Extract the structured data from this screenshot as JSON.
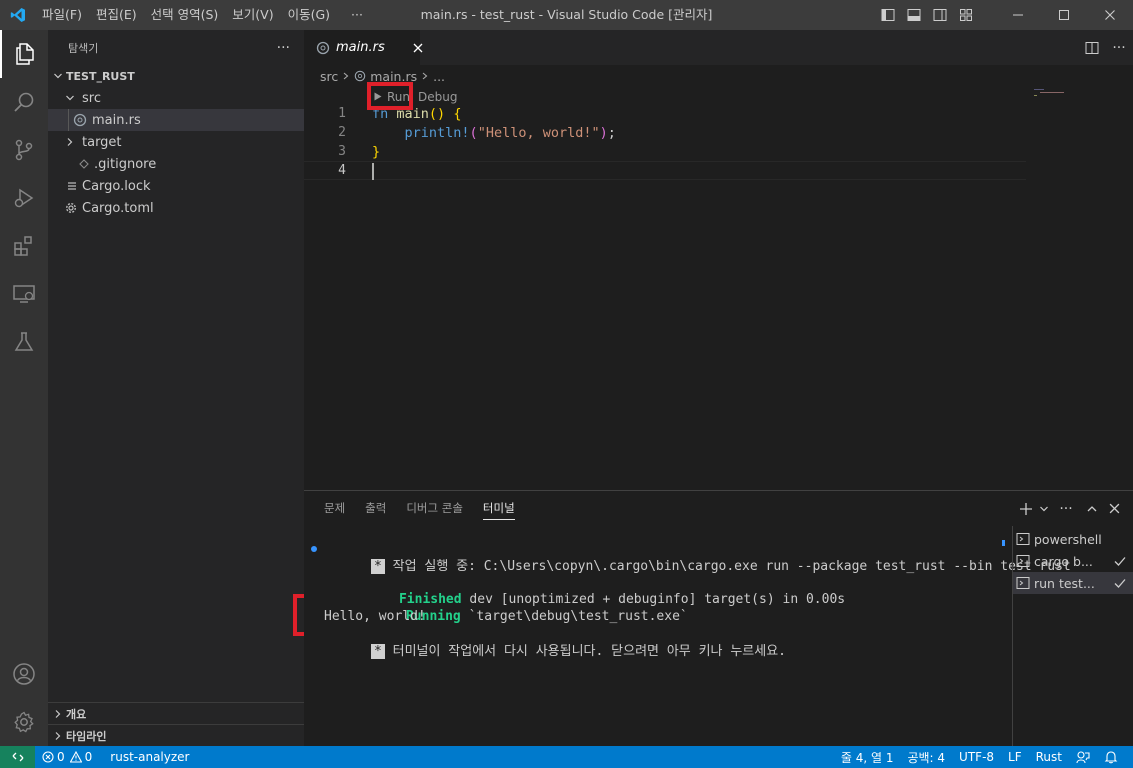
{
  "window": {
    "title": "main.rs - test_rust - Visual Studio Code [관리자]"
  },
  "menu": [
    {
      "label": "파일(F)"
    },
    {
      "label": "편집(E)"
    },
    {
      "label": "선택 영역(S)"
    },
    {
      "label": "보기(V)"
    },
    {
      "label": "이동(G)"
    },
    {
      "label": "···"
    }
  ],
  "explorer": {
    "title": "탐색기",
    "more": "···",
    "project": "TEST_RUST",
    "tree": [
      {
        "label": "src",
        "kind": "folder-open",
        "depth": 1
      },
      {
        "label": "main.rs",
        "kind": "rust-file",
        "depth": 2,
        "selected": true
      },
      {
        "label": "target",
        "kind": "folder-closed",
        "depth": 1
      },
      {
        "label": ".gitignore",
        "kind": "git-file",
        "depth": 1
      },
      {
        "label": "Cargo.lock",
        "kind": "lines-file",
        "depth": 1
      },
      {
        "label": "Cargo.toml",
        "kind": "gear-file",
        "depth": 1
      }
    ],
    "sections": [
      {
        "label": "개요"
      },
      {
        "label": "타임라인"
      }
    ]
  },
  "editor": {
    "tab": "main.rs",
    "breadcrumb": [
      "src",
      "main.rs",
      "..."
    ],
    "codelens": {
      "run": "Run",
      "debug": "Debug"
    },
    "lines": [
      {
        "no": "1",
        "text": "fn main() {"
      },
      {
        "no": "2",
        "text": "    println!(\"Hello, world!\");"
      },
      {
        "no": "3",
        "text": "}"
      },
      {
        "no": "4",
        "text": ""
      }
    ]
  },
  "panel": {
    "tabs": [
      {
        "label": "문제"
      },
      {
        "label": "출력"
      },
      {
        "label": "디버그 콘솔"
      },
      {
        "label": "터미널",
        "active": true
      }
    ],
    "terminal": {
      "task_label": "작업 실행 중: C:\\Users\\copyn\\.cargo\\bin\\cargo.exe run --package test_rust --bin test_rust",
      "finished_word": "Finished",
      "finished_rest": " dev [unoptimized + debuginfo] target(s) in 0.00s",
      "running_word": "Running",
      "running_rest": " `target\\debug\\test_rust.exe`",
      "output": "Hello, world!",
      "reuse_msg": "터미널이 작업에서 다시 사용됩니다. 닫으려면 아무 키나 누르세요."
    },
    "terminal_list": [
      {
        "label": "powershell",
        "check": false
      },
      {
        "label": "cargo b...",
        "check": true
      },
      {
        "label": "run test...",
        "check": true,
        "selected": true
      }
    ]
  },
  "status": {
    "errors": "0",
    "warnings": "0",
    "extension": "rust-analyzer",
    "position": "줄 4, 열 1",
    "spaces": "공백: 4",
    "encoding": "UTF-8",
    "eol": "LF",
    "language": "Rust"
  },
  "colors": {
    "accent": "#007acc",
    "remote": "#16825d",
    "highlight": "#e0202a"
  }
}
